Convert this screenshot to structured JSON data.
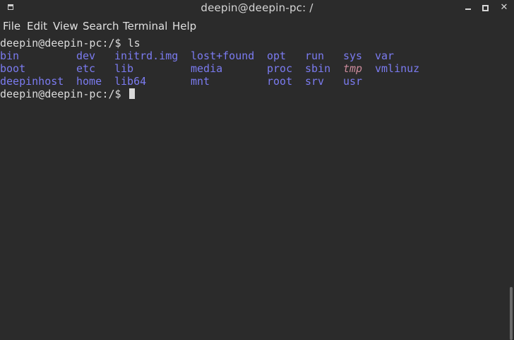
{
  "window": {
    "title": "deepin@deepin-pc: /"
  },
  "menu": {
    "items": [
      "File",
      "Edit",
      "View",
      "Search",
      "Terminal",
      "Help"
    ]
  },
  "terminal": {
    "prompt1": "deepin@deepin-pc:/$ ls",
    "ls_rows": [
      [
        "bin",
        "dev",
        "initrd.img",
        "lost+found",
        "opt",
        "run",
        "sys",
        "var"
      ],
      [
        "boot",
        "etc",
        "lib",
        "media",
        "proc",
        "sbin",
        "tmp",
        "vmlinuz"
      ],
      [
        "deepinhost",
        "home",
        "lib64",
        "mnt",
        "root",
        "srv",
        "usr",
        ""
      ]
    ],
    "prompt2": "deepin@deepin-pc:/$ "
  },
  "colors": {
    "background": "#2b2b2b",
    "directory": "#7b7bf0",
    "sticky_dir": "#c98a9a",
    "text": "#dcdcdc"
  }
}
